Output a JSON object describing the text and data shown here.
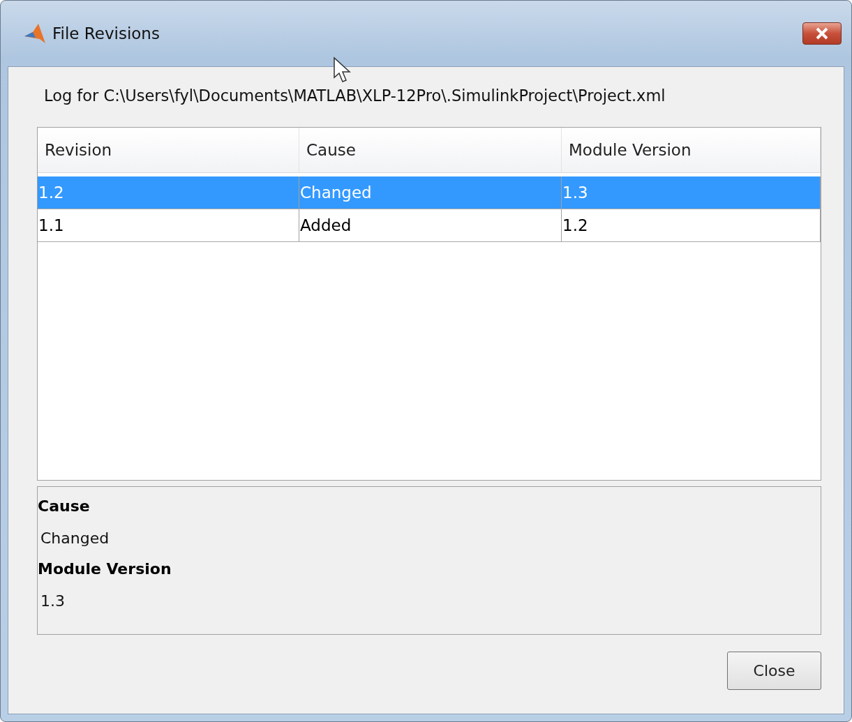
{
  "window": {
    "title": "File Revisions"
  },
  "log_label": "Log for C:\\Users\\fyl\\Documents\\MATLAB\\XLP-12Pro\\.SimulinkProject\\Project.xml",
  "table": {
    "columns": [
      "Revision",
      "Cause",
      "Module Version"
    ],
    "rows": [
      {
        "cells": [
          "1.2",
          "Changed",
          "1.3"
        ],
        "selected": true
      },
      {
        "cells": [
          "1.1",
          "Added",
          "1.2"
        ],
        "selected": false
      }
    ]
  },
  "details": [
    {
      "label": "Cause",
      "value": "Changed"
    },
    {
      "label": "Module Version",
      "value": "1.3"
    }
  ],
  "buttons": [
    "Close"
  ]
}
